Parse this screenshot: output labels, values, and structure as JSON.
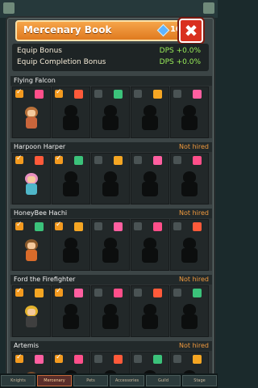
{
  "window": {
    "title": "Mercenary Book",
    "gem_count": "10",
    "close_glyph": "✖"
  },
  "bonus": {
    "equip_label": "Equip Bonus",
    "equip_value": "DPS +0.0%",
    "completion_label": "Equip Completion Bonus",
    "completion_value": "DPS +0.0%"
  },
  "mercenaries": [
    {
      "name": "Flying Falcon",
      "status": "",
      "hired": true,
      "colors": {
        "head": "#b9713a",
        "body": "#c9653b"
      }
    },
    {
      "name": "Harpoon Harper",
      "status": "Not hired",
      "hired": false,
      "colors": {
        "head": "#e88fc0",
        "body": "#4fb7c9"
      }
    },
    {
      "name": "HoneyBee Hachi",
      "status": "Not hired",
      "hired": false,
      "colors": {
        "head": "#8a5a2c",
        "body": "#d96b2a"
      }
    },
    {
      "name": "Ford the Firefighter",
      "status": "Not hired",
      "hired": false,
      "colors": {
        "head": "#e3b22c",
        "body": "#3f3f3f"
      }
    },
    {
      "name": "Artemis",
      "status": "Not hired",
      "hired": false,
      "colors": {
        "head": "#7a4c2b",
        "body": "#5d7b3b"
      }
    }
  ],
  "equipment_icons": [
    "feather-icon",
    "flame-icon",
    "leaf-icon",
    "sun-icon",
    "lightning-icon"
  ],
  "equipment_colors": [
    "#ff4f8a",
    "#ff5a3a",
    "#3bc27a",
    "#f5a623",
    "#ff5fa0"
  ],
  "bottom_tabs": [
    "Knights",
    "Mercenary",
    "Pets",
    "Accessories",
    "Guild",
    "Stage"
  ]
}
